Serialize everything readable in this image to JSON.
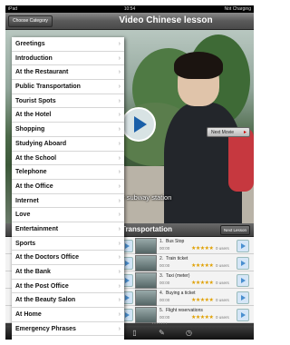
{
  "status_bar": {
    "left": "iPad ",
    "time": "10:54",
    "right": "Not Charging"
  },
  "header": {
    "choose_category": "Choose Category",
    "title": "Video Chinese lesson"
  },
  "video": {
    "subtitle": "or subway station",
    "next_movie": "Next Movie"
  },
  "lesson_panel": {
    "title": "Transportation",
    "next_lesson": "Next Lesson",
    "lessons": [
      {
        "number": "1.",
        "name": "Bus Stop",
        "time": "00:00",
        "users": "0 users"
      },
      {
        "number": "2.",
        "name": "Train ticket",
        "time": "00:00",
        "users": "0 users"
      },
      {
        "number": "3.",
        "name": "Taxi (meter)",
        "time": "00:00",
        "users": "0 users"
      },
      {
        "number": "4.",
        "name": "Buying a ticket",
        "time": "00:00",
        "users": "0 users"
      },
      {
        "number": "5.",
        "name": "Flight reservations",
        "time": "00:00",
        "users": "0 users"
      }
    ],
    "stars": "★★★★★"
  },
  "menu": {
    "items": [
      "Greetings",
      "Introduction",
      "At the Restaurant",
      "Public Transportation",
      "Tourist Spots",
      "At the Hotel",
      "Shopping",
      "Studying Aboard",
      "At the School",
      "Telephone",
      "At the Office",
      "Internet",
      "Love",
      "Entertainment",
      "Sports",
      "At the Doctors Office",
      "At the Bank",
      "At the Post Office",
      "At the Beauty Salon",
      "At Home",
      "Emergency Phrases"
    ],
    "chevron": "›"
  },
  "colors": {
    "accent_blue": "#1a5fa8",
    "star": "#e0a000"
  }
}
